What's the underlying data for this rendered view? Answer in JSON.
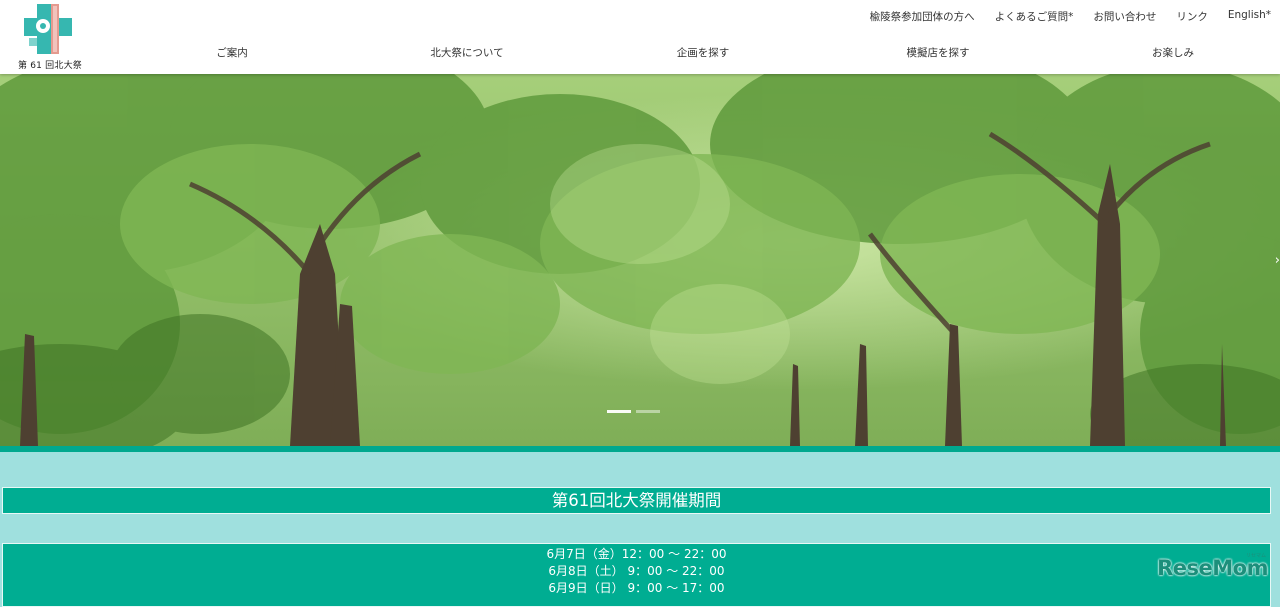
{
  "header": {
    "logo_text": "第 61 回北大祭",
    "utility_links": [
      "楡陵祭参加団体の方へ",
      "よくあるご質問*",
      "お問い合わせ",
      "リンク",
      "English*"
    ],
    "nav": [
      "ご案内",
      "北大祭について",
      "企画を探す",
      "模擬店を探す",
      "お楽しみ"
    ]
  },
  "hero": {
    "next_arrow": "›",
    "slides_count": 2,
    "active_slide": 1
  },
  "main": {
    "period_title": "第61回北大祭開催期間",
    "schedule": [
      "6月7日（金）12：00 〜 22：00",
      "6月8日（土） 9：00 〜 22：00",
      "6月9日（日） 9：00 〜 17：00"
    ]
  },
  "watermark": {
    "text": "ReseMom",
    "sub": "リセマム"
  },
  "colors": {
    "accent": "#00ad92",
    "page_background": "#9fe0de",
    "header_background": "#ffffff"
  }
}
